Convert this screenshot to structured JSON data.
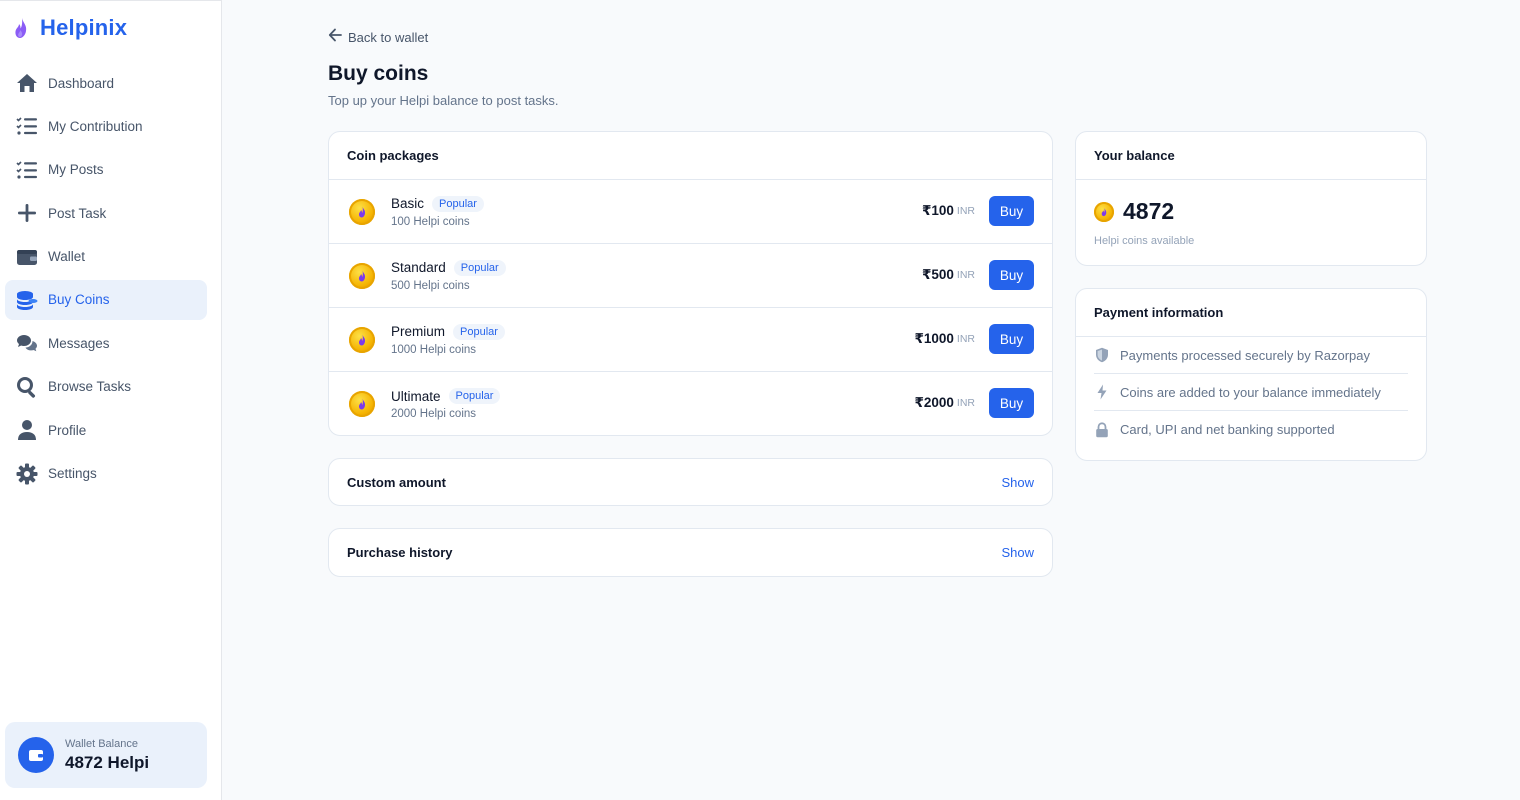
{
  "brand": {
    "name": "Helpinix"
  },
  "sidebar": {
    "items": [
      {
        "label": "Dashboard",
        "icon": "home-icon"
      },
      {
        "label": "My Contribution",
        "icon": "list-check-icon"
      },
      {
        "label": "My Posts",
        "icon": "list-check-icon"
      },
      {
        "label": "Post Task",
        "icon": "plus-icon"
      },
      {
        "label": "Wallet",
        "icon": "wallet-icon"
      },
      {
        "label": "Buy Coins",
        "icon": "coins-stack-icon",
        "active": true
      },
      {
        "label": "Messages",
        "icon": "chat-bubbles-icon"
      },
      {
        "label": "Browse Tasks",
        "icon": "search-icon"
      },
      {
        "label": "Profile",
        "icon": "user-icon"
      },
      {
        "label": "Settings",
        "icon": "gear-icon"
      }
    ],
    "wallet": {
      "label": "Wallet Balance",
      "value": "4872 Helpi"
    }
  },
  "main": {
    "back_label": "Back to wallet",
    "title": "Buy coins",
    "subtitle": "Top up your Helpi balance to post tasks.",
    "packages_card": {
      "title": "Coin packages",
      "items": [
        {
          "name": "Basic",
          "badge": "Popular",
          "coins": "100 Helpi coins",
          "price": "₹100",
          "currency": "INR",
          "button": "Buy"
        },
        {
          "name": "Standard",
          "badge": "Popular",
          "coins": "500 Helpi coins",
          "price": "₹500",
          "currency": "INR",
          "button": "Buy"
        },
        {
          "name": "Premium",
          "badge": "Popular",
          "coins": "1000 Helpi coins",
          "price": "₹1000",
          "currency": "INR",
          "button": "Buy"
        },
        {
          "name": "Ultimate",
          "badge": "Popular",
          "coins": "2000 Helpi coins",
          "price": "₹2000",
          "currency": "INR",
          "button": "Buy"
        }
      ]
    },
    "custom_amount": {
      "title": "Custom amount",
      "action": "Show"
    },
    "purchase_history": {
      "title": "Purchase history",
      "action": "Show"
    }
  },
  "right": {
    "balance": {
      "title": "Your balance",
      "value": "4872",
      "caption": "Helpi coins available"
    },
    "payment_info": {
      "title": "Payment information",
      "items": [
        {
          "text": "Payments processed securely by Razorpay",
          "icon": "shield-icon"
        },
        {
          "text": "Coins are added to your balance immediately",
          "icon": "lightning-icon"
        },
        {
          "text": "Card, UPI and net banking supported",
          "icon": "lock-icon"
        }
      ]
    }
  },
  "colors": {
    "accent": "#2563eb",
    "accent_soft": "#eaf1fb",
    "coin": "#f5b301"
  }
}
